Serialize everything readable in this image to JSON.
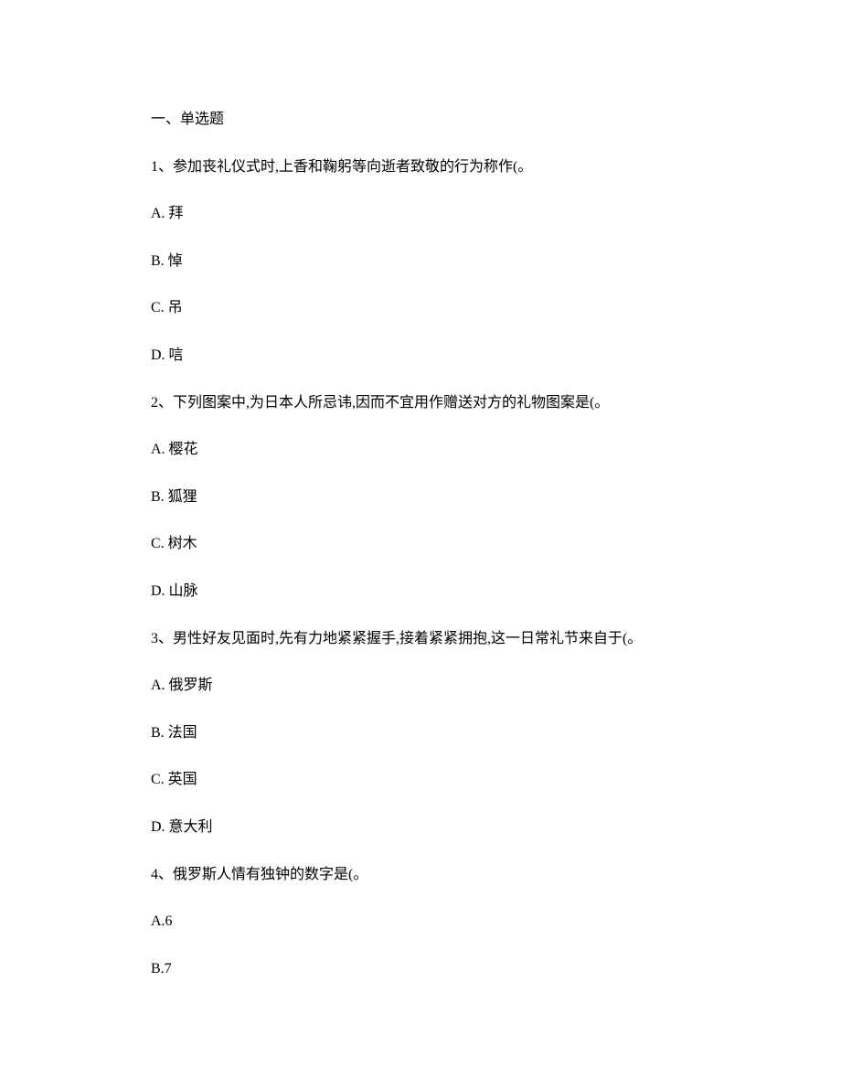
{
  "section_title": "一、单选题",
  "questions": [
    {
      "stem": "1、参加丧礼仪式时,上香和鞠躬等向逝者致敬的行为称作(。",
      "options": [
        "A. 拜",
        "B. 悼",
        "C. 吊",
        "D. 唁"
      ]
    },
    {
      "stem": "2、下列图案中,为日本人所忌讳,因而不宜用作赠送对方的礼物图案是(。",
      "options": [
        "A. 樱花",
        "B. 狐狸",
        "C. 树木",
        "D. 山脉"
      ]
    },
    {
      "stem": "3、男性好友见面时,先有力地紧紧握手,接着紧紧拥抱,这一日常礼节来自于(。",
      "options": [
        "A. 俄罗斯",
        "B. 法国",
        "C. 英国",
        "D. 意大利"
      ]
    },
    {
      "stem": "4、俄罗斯人情有独钟的数字是(。",
      "options": [
        "A.6",
        "B.7"
      ]
    }
  ]
}
